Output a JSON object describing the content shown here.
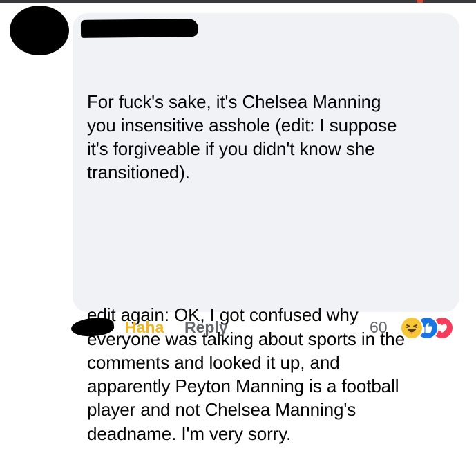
{
  "comment": {
    "paragraphs": [
      "For fuck's sake, it's Chelsea Manning\nyou insensitive asshole (edit: I suppose\nit's forgiveable if you didn't know she\ntransitioned).",
      "edit again: OK, I got confused why\neveryone was talking about sports in the\ncomments and looked it up, and\napparently Peyton Manning is a football\nplayer and not Chelsea Manning's\ndeadname. I'm very sorry."
    ]
  },
  "actions": {
    "reaction_label": "Haha",
    "reply_label": "Reply"
  },
  "reactions": {
    "count": "60",
    "icons": [
      "haha-icon",
      "like-icon",
      "love-icon"
    ]
  },
  "colors": {
    "bubble": "#f0f2f5",
    "haha_text": "#f2b61f",
    "secondary_text": "#65676b",
    "like": "#1b74e4",
    "love": "#f23e5c",
    "haha": "#f7c736"
  }
}
